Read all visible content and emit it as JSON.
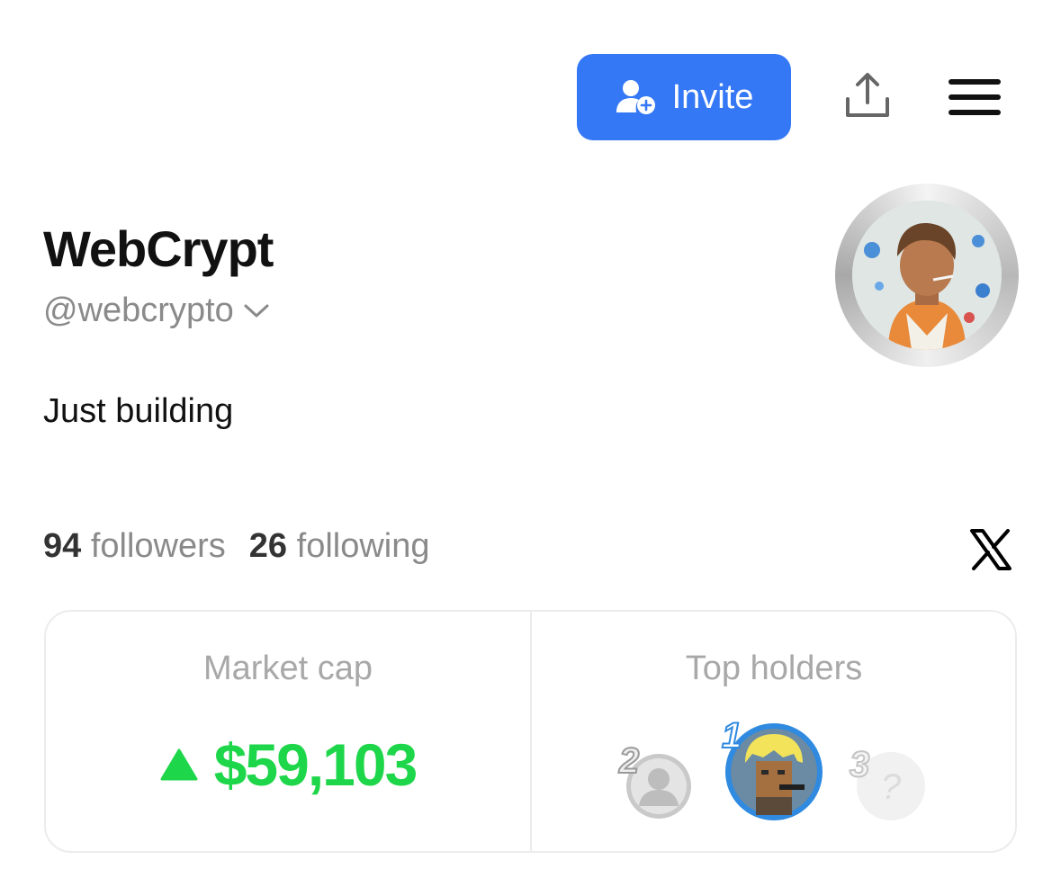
{
  "header": {
    "invite_label": "Invite",
    "share_icon": "share-icon",
    "menu_icon": "hamburger-menu-icon"
  },
  "profile": {
    "name": "WebCrypt",
    "handle": "@webcrypto",
    "bio": "Just building",
    "followers_count": "94",
    "followers_label": "followers",
    "following_count": "26",
    "following_label": "following"
  },
  "card": {
    "market_cap_label": "Market cap",
    "market_cap_value": "$59,103",
    "top_holders_label": "Top holders",
    "holders": [
      {
        "rank": "1"
      },
      {
        "rank": "2"
      },
      {
        "rank": "3"
      }
    ]
  },
  "colors": {
    "accent": "#3478f6",
    "positive": "#1ed64a"
  }
}
